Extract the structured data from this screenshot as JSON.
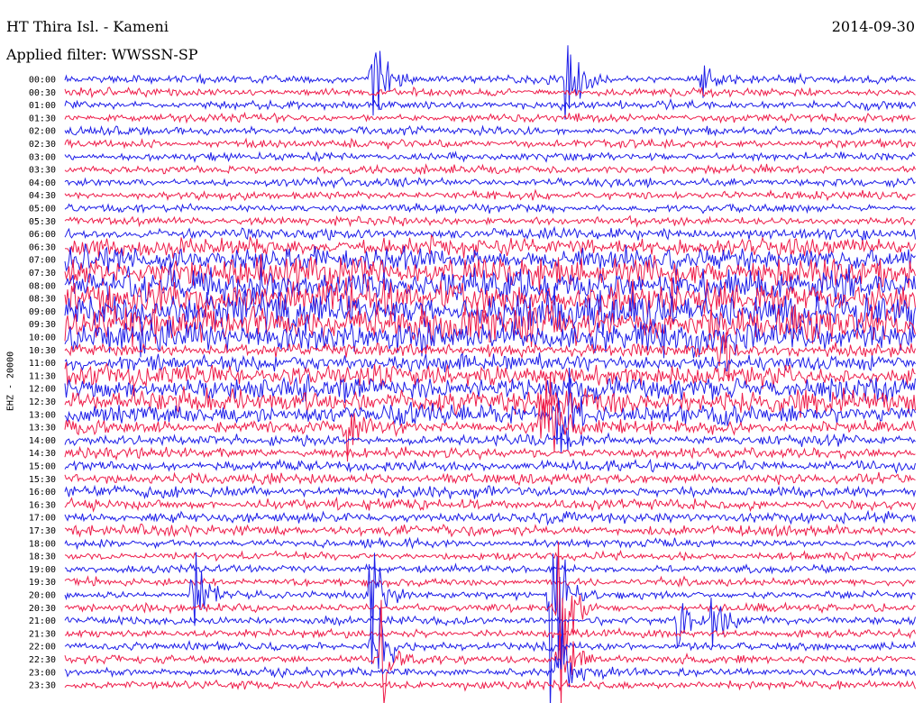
{
  "header": {
    "station": "HT Thira Isl. - Kameni",
    "date": "2014-09-30",
    "filter": "Applied filter: WWSSN-SP"
  },
  "channel_label": "EHZ - 20000",
  "colors": {
    "trace_a": "#1d1de8",
    "trace_b": "#ee1d4a",
    "background": "#ffffff",
    "text": "#000000"
  },
  "chart_data": {
    "type": "helicorder",
    "row_labels": [
      "00:00",
      "00:30",
      "01:00",
      "01:30",
      "02:00",
      "02:30",
      "03:00",
      "03:30",
      "04:00",
      "04:30",
      "05:00",
      "05:30",
      "06:00",
      "06:30",
      "07:00",
      "07:30",
      "08:00",
      "08:30",
      "09:00",
      "09:30",
      "10:00",
      "10:30",
      "11:00",
      "11:30",
      "12:00",
      "12:30",
      "13:00",
      "13:30",
      "14:00",
      "14:30",
      "15:00",
      "15:30",
      "16:00",
      "16:30",
      "17:00",
      "17:30",
      "18:00",
      "18:30",
      "19:00",
      "19:30",
      "20:00",
      "20:30",
      "21:00",
      "21:30",
      "22:00",
      "22:30",
      "23:00",
      "23:30"
    ],
    "row_minutes": 30,
    "trace_colors": [
      "trace_a",
      "trace_b"
    ],
    "noise_level": [
      3,
      3,
      3,
      3,
      3,
      3,
      3,
      3,
      3,
      3,
      3,
      3,
      4,
      7,
      9,
      11,
      12,
      13,
      14,
      14,
      12,
      5,
      6,
      8,
      9,
      9,
      7,
      5,
      4,
      4,
      4,
      4,
      4,
      4,
      4,
      4,
      3,
      3,
      3,
      3,
      3,
      3,
      3,
      3,
      3,
      3,
      3,
      3
    ],
    "bursts": [
      {
        "row": 0,
        "t": 0.36,
        "amp": 75
      },
      {
        "row": 0,
        "t": 0.59,
        "amp": 55
      },
      {
        "row": 0,
        "t": 0.75,
        "amp": 22
      },
      {
        "row": 21,
        "t": 0.77,
        "amp": 40
      },
      {
        "row": 26,
        "t": 0.58,
        "amp": 90
      },
      {
        "row": 27,
        "t": 0.56,
        "amp": 80
      },
      {
        "row": 27,
        "t": 0.33,
        "amp": 35
      },
      {
        "row": 40,
        "t": 0.15,
        "amp": 50
      },
      {
        "row": 40,
        "t": 0.36,
        "amp": 60
      },
      {
        "row": 40,
        "t": 0.57,
        "amp": 140
      },
      {
        "row": 41,
        "t": 0.58,
        "amp": 120
      },
      {
        "row": 42,
        "t": 0.72,
        "amp": 35
      },
      {
        "row": 42,
        "t": 0.76,
        "amp": 30
      },
      {
        "row": 44,
        "t": 0.36,
        "amp": 80
      },
      {
        "row": 45,
        "t": 0.37,
        "amp": 60
      },
      {
        "row": 45,
        "t": 0.58,
        "amp": 70
      },
      {
        "row": 46,
        "t": 0.58,
        "amp": 60
      }
    ]
  }
}
